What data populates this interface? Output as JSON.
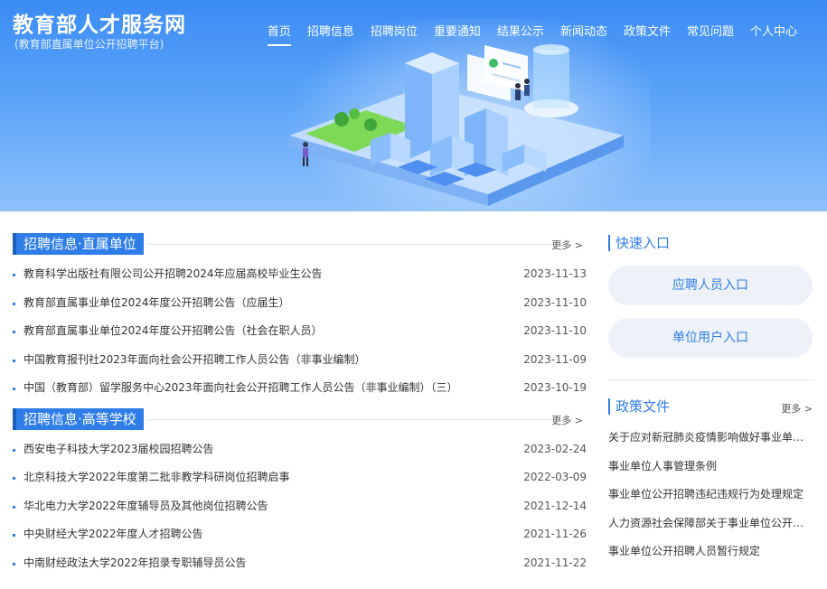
{
  "header": {
    "site_title": "教育部人才服务网",
    "site_subtitle": "(教育部直属单位公开招聘平台)",
    "nav": [
      {
        "label": "首页",
        "active": true
      },
      {
        "label": "招聘信息"
      },
      {
        "label": "招聘岗位"
      },
      {
        "label": "重要通知"
      },
      {
        "label": "结果公示"
      },
      {
        "label": "新闻动态"
      },
      {
        "label": "政策文件"
      },
      {
        "label": "常见问题"
      },
      {
        "label": "个人中心"
      }
    ]
  },
  "section_direct": {
    "title": "招聘信息·直属单位",
    "more": "更多 >",
    "items": [
      {
        "title": "教育科学出版社有限公司公开招聘2024年应届高校毕业生公告",
        "date": "2023-11-13"
      },
      {
        "title": "教育部直属事业单位2024年度公开招聘公告（应届生）",
        "date": "2023-11-10"
      },
      {
        "title": "教育部直属事业单位2024年度公开招聘公告（社会在职人员）",
        "date": "2023-11-10"
      },
      {
        "title": "中国教育报刊社2023年面向社会公开招聘工作人员公告（非事业编制）",
        "date": "2023-11-09"
      },
      {
        "title": "中国（教育部）留学服务中心2023年面向社会公开招聘工作人员公告（非事业编制）（三）",
        "date": "2023-10-19"
      }
    ]
  },
  "section_higher": {
    "title": "招聘信息·高等学校",
    "more": "更多 >",
    "items": [
      {
        "title": "西安电子科技大学2023届校园招聘公告",
        "date": "2023-02-24"
      },
      {
        "title": "北京科技大学2022年度第二批非教学科研岗位招聘启事",
        "date": "2022-03-09"
      },
      {
        "title": "华北电力大学2022年度辅导员及其他岗位招聘公告",
        "date": "2021-12-14"
      },
      {
        "title": "中央财经大学2022年度人才招聘公告",
        "date": "2021-11-26"
      },
      {
        "title": "中南财经政法大学2022年招录专职辅导员公告",
        "date": "2021-11-22"
      }
    ]
  },
  "quick_entry": {
    "title": "快速入口",
    "applicant_label": "应聘人员入口",
    "employer_label": "单位用户入口"
  },
  "policy": {
    "title": "政策文件",
    "more": "更多 >",
    "items": [
      "关于应对新冠肺炎疫情影响做好事业单位公开招聘高校毕业生工作的通知",
      "事业单位人事管理条例",
      "事业单位公开招聘违纪违规行为处理规定",
      "人力资源社会保障部关于事业单位公开招聘岗位条件设置有关问题的通知",
      "事业单位公开招聘人员暂行规定"
    ]
  },
  "colors": {
    "accent": "#2f7de8",
    "banner_top": "#3b8bf5",
    "entry_bg": "#eef2f8"
  }
}
